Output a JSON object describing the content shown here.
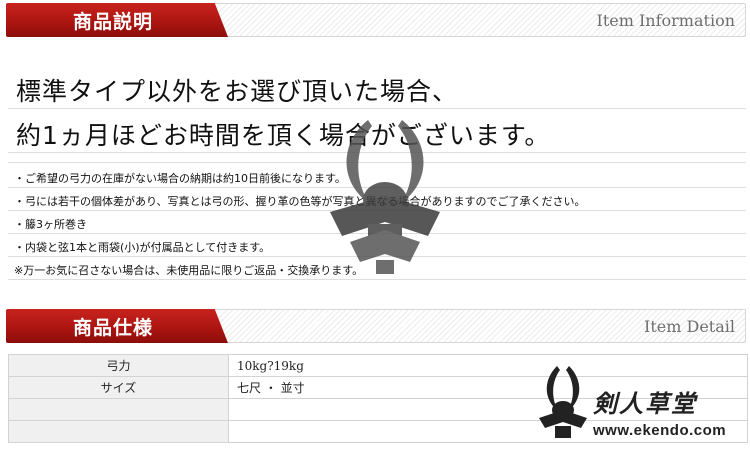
{
  "info_section": {
    "title": "商品説明",
    "subtitle": "Item Information"
  },
  "headline": [
    "標準タイプ以外をお選び頂いた場合、",
    "約1ヵ月ほどお時間を頂く場合がございます。"
  ],
  "notes": [
    "・ご希望の弓力の在庫がない場合の納期は約10日前後になります。",
    "・弓には若干の個体差があり、写真とは弓の形、握り革の色等が写真と異なる場合がありますのでご了承ください。",
    "・籐3ヶ所巻き",
    "・内袋と弦1本と雨袋(小)が付属品として付きます。",
    "※万一お気に召さない場合は、未使用品に限りご返品・交換承ります。"
  ],
  "detail_section": {
    "title": "商品仕様",
    "subtitle": "Item Detail"
  },
  "spec_rows": [
    {
      "label": "弓力",
      "value": "10kg?19kg"
    },
    {
      "label": "サイズ",
      "value": "七尺 ・ 並寸"
    },
    {
      "label": "",
      "value": ""
    },
    {
      "label": "",
      "value": ""
    }
  ],
  "brand": {
    "name": "剣人草堂",
    "url": "www.ekendo.com"
  },
  "colors": {
    "accent_red": "#a91410",
    "table_label_bg": "#f0f0f0",
    "border": "#d3d3d3"
  }
}
